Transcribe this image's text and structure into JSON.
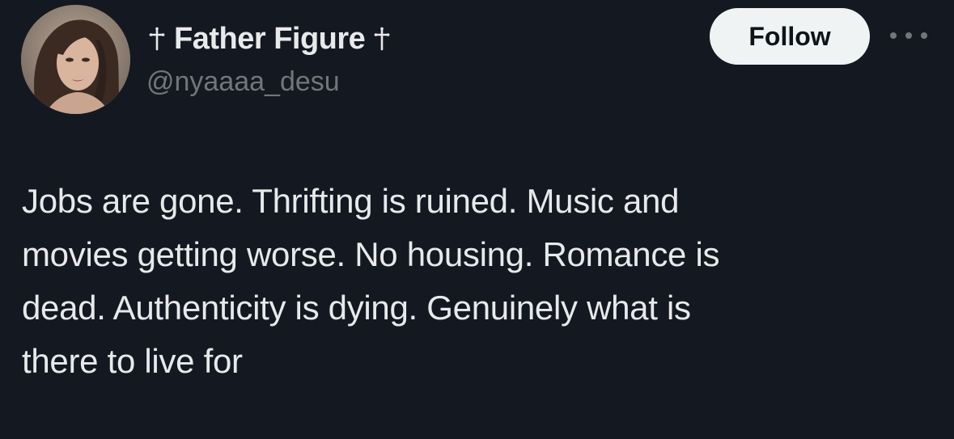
{
  "author": {
    "display_name": "Father Figure",
    "name_prefix_symbol": "cross-icon",
    "name_suffix_symbol": "cross-icon",
    "handle": "@nyaaaa_desu"
  },
  "actions": {
    "follow_label": "Follow",
    "more_icon": "more-horizontal-icon"
  },
  "tweet": {
    "lines": [
      "Jobs are gone. Thrifting is ruined. Music and",
      "movies getting worse. No housing. Romance is",
      "dead. Authenticity is dying. Genuinely what is",
      "there to live for"
    ]
  },
  "colors": {
    "background": "#141821",
    "text_primary": "#e7e9ea",
    "text_secondary": "#71767b",
    "follow_button_bg": "#eff3f4",
    "follow_button_text": "#0f1419"
  }
}
